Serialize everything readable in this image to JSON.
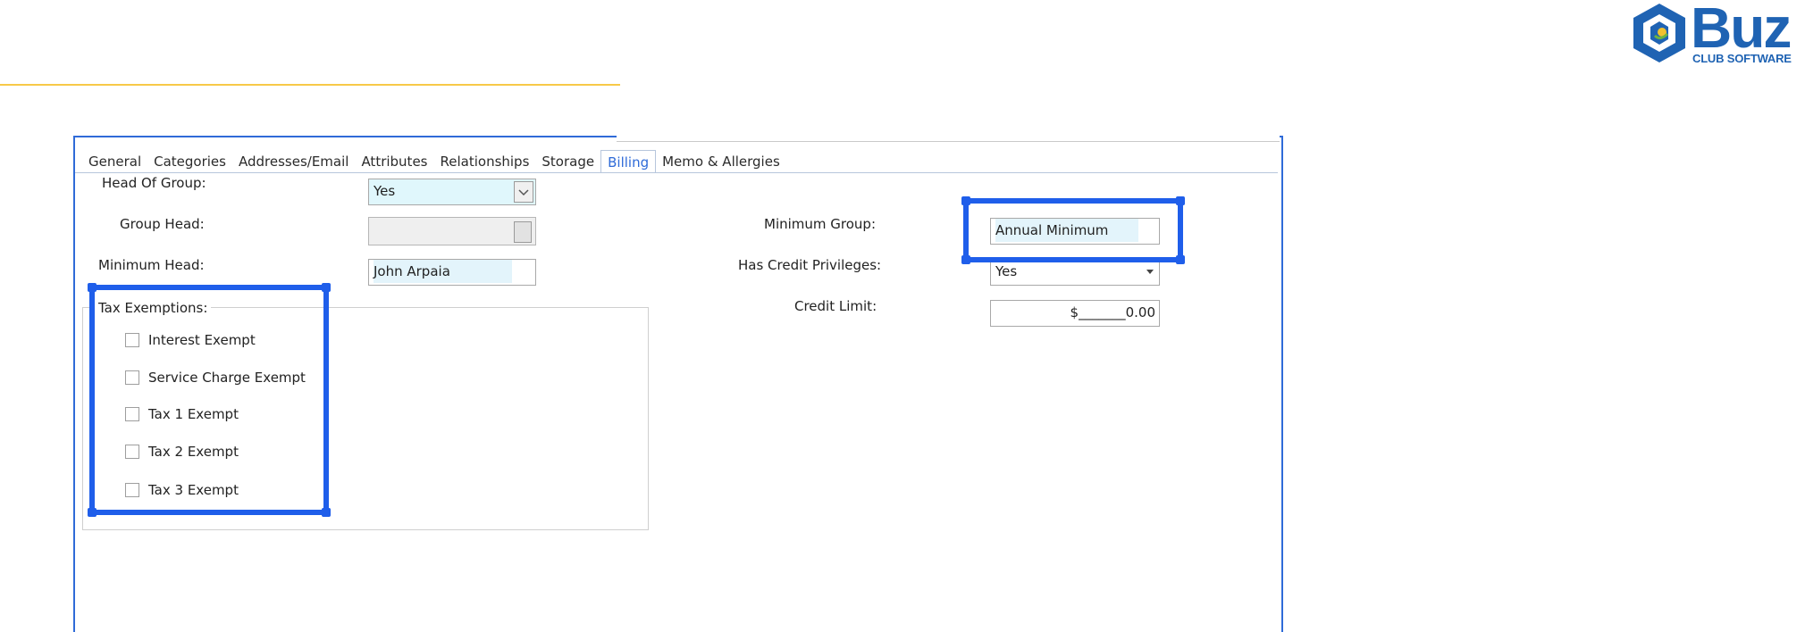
{
  "logo": {
    "main_text": "Buz",
    "sub_text": "CLUB SOFTWARE",
    "color": "#1f63b3"
  },
  "tabs": [
    {
      "label": "General"
    },
    {
      "label": "Categories"
    },
    {
      "label": "Addresses/Email"
    },
    {
      "label": "Attributes"
    },
    {
      "label": "Relationships"
    },
    {
      "label": "Storage"
    },
    {
      "label": "Billing",
      "active": true
    },
    {
      "label": "Memo & Allergies"
    }
  ],
  "form": {
    "head_of_group": {
      "label": "Head Of Group:",
      "value": "Yes"
    },
    "group_head": {
      "label": "Group Head:",
      "value": ""
    },
    "minimum_head": {
      "label": "Minimum Head:",
      "value": "John Arpaia"
    },
    "minimum_group": {
      "label": "Minimum Group:",
      "value": "Annual Minimum"
    },
    "has_credit_privileges": {
      "label": "Has Credit Privileges:",
      "value": "Yes"
    },
    "credit_limit": {
      "label": "Credit Limit:",
      "value": "$_______0.00"
    }
  },
  "tax_exemptions": {
    "title": "Tax Exemptions:",
    "items": [
      {
        "label": "Interest Exempt",
        "checked": false
      },
      {
        "label": "Service Charge Exempt",
        "checked": false
      },
      {
        "label": "Tax 1 Exempt",
        "checked": false
      },
      {
        "label": "Tax 2 Exempt",
        "checked": false
      },
      {
        "label": "Tax 3 Exempt",
        "checked": false
      }
    ]
  },
  "colors": {
    "highlight_box": "#1f5eea",
    "accent_line": "#f7c948",
    "active_tab": "#2f6bd8"
  }
}
